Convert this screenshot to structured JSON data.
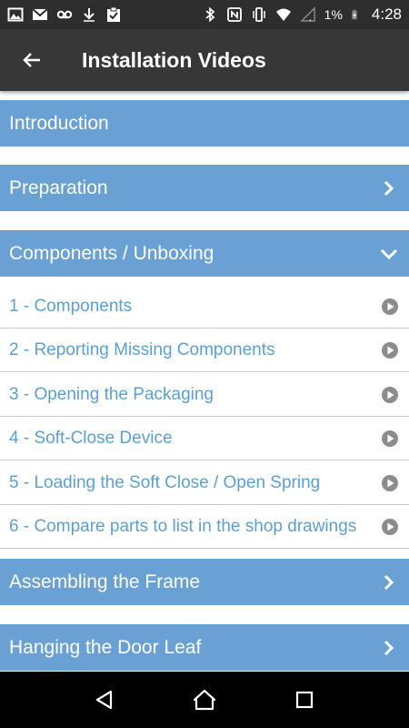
{
  "status_bar": {
    "battery_percent": "1%",
    "time": "4:28",
    "icons": [
      "image-icon",
      "gmail-icon",
      "voicemail-icon",
      "download-icon",
      "clipboard-check-icon",
      "bluetooth-icon",
      "nfc-icon",
      "vibrate-icon",
      "wifi-icon",
      "signal-icon",
      "battery-charging-icon"
    ]
  },
  "app_bar": {
    "title": "Installation Videos",
    "back_icon": "arrow-left-icon"
  },
  "sections": [
    {
      "title": "Introduction",
      "expanded": false,
      "icon": ""
    },
    {
      "title": "Preparation",
      "expanded": false,
      "icon": "chevron-right-icon"
    },
    {
      "title": "Components / Unboxing",
      "expanded": true,
      "icon": "chevron-down-icon"
    },
    {
      "title": "Assembling the Frame",
      "expanded": false,
      "icon": "chevron-right-icon"
    },
    {
      "title": "Hanging the Door Leaf",
      "expanded": false,
      "icon": "chevron-right-icon"
    }
  ],
  "components_items": [
    {
      "label": "1 - Components"
    },
    {
      "label": "2 - Reporting Missing Components"
    },
    {
      "label": "3 - Opening the Packaging"
    },
    {
      "label": "4 - Soft-Close Device"
    },
    {
      "label": "5 - Loading the Soft Close / Open Spring"
    },
    {
      "label": "6 - Compare parts to list in the shop drawings"
    }
  ],
  "colors": {
    "section_header": "#6aa1d5",
    "item_text": "#5aa0d8",
    "app_bar": "#373737",
    "status_bar": "#2e2e2e"
  },
  "nav_bar": {
    "buttons": [
      "back-triangle-icon",
      "home-icon",
      "recents-square-icon"
    ]
  }
}
